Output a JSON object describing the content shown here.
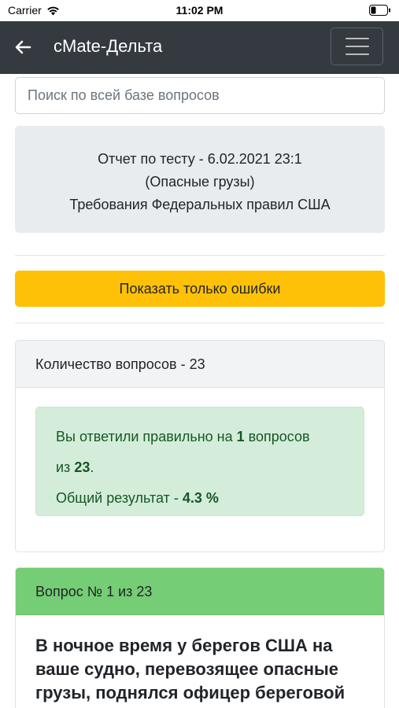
{
  "status_bar": {
    "carrier": "Carrier",
    "time": "11:02 PM"
  },
  "navbar": {
    "title": "cMate-Дельта"
  },
  "search": {
    "placeholder": "Поиск по всей базе вопросов"
  },
  "report": {
    "line1": "Отчет по тесту - 6.02.2021 23:1",
    "line2": "(Опасные грузы)",
    "line3": "Требования Федеральных правил США"
  },
  "filter_button": {
    "label": "Показать только ошибки"
  },
  "summary": {
    "header": "Количество вопросов - 23",
    "correct_prefix": "Вы ответили правильно на ",
    "correct_count": "1",
    "correct_mid": " вопросов",
    "of_prefix": "из ",
    "total": "23",
    "of_suffix": ".",
    "result_prefix": "Общий результат - ",
    "result_value": "4.3 %"
  },
  "question": {
    "header": "Вопрос № 1 из 23",
    "text": "В ночное время у берегов США на ваше судно, перевозящее опасные грузы, поднялся офицер береговой"
  },
  "colors": {
    "navbar": "#343a40",
    "warning": "#ffc107",
    "success_bg": "#d4edda",
    "success_text": "#155724",
    "question_header": "#75cd75"
  }
}
